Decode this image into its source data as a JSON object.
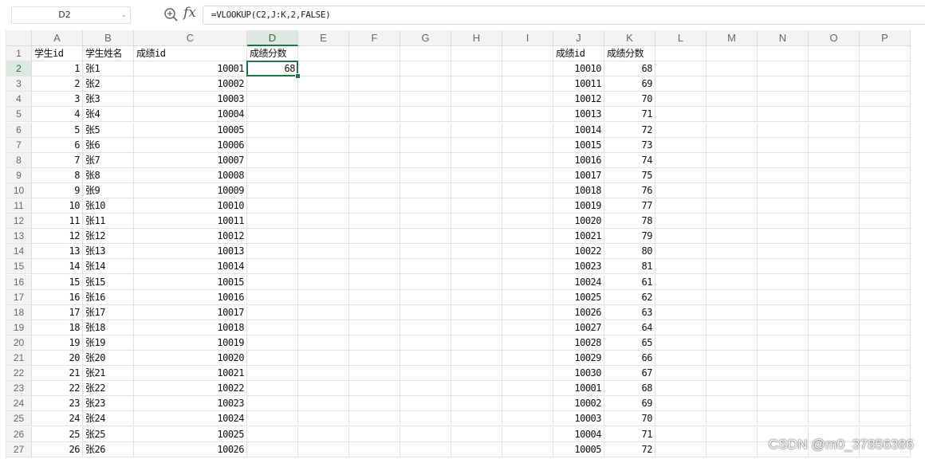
{
  "formula_bar": {
    "namebox": "D2",
    "fx_label": "fx",
    "formula": "=VLOOKUP(C2,J:K,2,FALSE)"
  },
  "columns": [
    "A",
    "B",
    "C",
    "D",
    "E",
    "F",
    "G",
    "H",
    "I",
    "J",
    "K",
    "L",
    "M",
    "N",
    "O",
    "P"
  ],
  "selected_column": "D",
  "selected_row": 2,
  "rows": [
    1,
    2,
    3,
    4,
    5,
    6,
    7,
    8,
    9,
    10,
    11,
    12,
    13,
    14,
    15,
    16,
    17,
    18,
    19,
    20,
    21,
    22,
    23,
    24,
    25,
    26,
    27
  ],
  "left_headers": [
    "学生id",
    "学生姓名",
    "成绩id",
    "成绩分数"
  ],
  "left_table": [
    [
      "1",
      "张1",
      "10001",
      "68"
    ],
    [
      "2",
      "张2",
      "10002",
      ""
    ],
    [
      "3",
      "张3",
      "10003",
      ""
    ],
    [
      "4",
      "张4",
      "10004",
      ""
    ],
    [
      "5",
      "张5",
      "10005",
      ""
    ],
    [
      "6",
      "张6",
      "10006",
      ""
    ],
    [
      "7",
      "张7",
      "10007",
      ""
    ],
    [
      "8",
      "张8",
      "10008",
      ""
    ],
    [
      "9",
      "张9",
      "10009",
      ""
    ],
    [
      "10",
      "张10",
      "10010",
      ""
    ],
    [
      "11",
      "张11",
      "10011",
      ""
    ],
    [
      "12",
      "张12",
      "10012",
      ""
    ],
    [
      "13",
      "张13",
      "10013",
      ""
    ],
    [
      "14",
      "张14",
      "10014",
      ""
    ],
    [
      "15",
      "张15",
      "10015",
      ""
    ],
    [
      "16",
      "张16",
      "10016",
      ""
    ],
    [
      "17",
      "张17",
      "10017",
      ""
    ],
    [
      "18",
      "张18",
      "10018",
      ""
    ],
    [
      "19",
      "张19",
      "10019",
      ""
    ],
    [
      "20",
      "张20",
      "10020",
      ""
    ],
    [
      "21",
      "张21",
      "10021",
      ""
    ],
    [
      "22",
      "张22",
      "10022",
      ""
    ],
    [
      "23",
      "张23",
      "10023",
      ""
    ],
    [
      "24",
      "张24",
      "10024",
      ""
    ],
    [
      "25",
      "张25",
      "10025",
      ""
    ],
    [
      "26",
      "张26",
      "10026",
      ""
    ]
  ],
  "right_headers": [
    "成绩id",
    "成绩分数"
  ],
  "right_table": [
    [
      "10010",
      "68"
    ],
    [
      "10011",
      "69"
    ],
    [
      "10012",
      "70"
    ],
    [
      "10013",
      "71"
    ],
    [
      "10014",
      "72"
    ],
    [
      "10015",
      "73"
    ],
    [
      "10016",
      "74"
    ],
    [
      "10017",
      "75"
    ],
    [
      "10018",
      "76"
    ],
    [
      "10019",
      "77"
    ],
    [
      "10020",
      "78"
    ],
    [
      "10021",
      "79"
    ],
    [
      "10022",
      "80"
    ],
    [
      "10023",
      "81"
    ],
    [
      "10024",
      "61"
    ],
    [
      "10025",
      "62"
    ],
    [
      "10026",
      "63"
    ],
    [
      "10027",
      "64"
    ],
    [
      "10028",
      "65"
    ],
    [
      "10029",
      "66"
    ],
    [
      "10030",
      "67"
    ],
    [
      "10001",
      "68"
    ],
    [
      "10002",
      "69"
    ],
    [
      "10003",
      "70"
    ],
    [
      "10004",
      "71"
    ],
    [
      "10005",
      "72"
    ]
  ],
  "watermark": "CSDN @m0_37856386",
  "colors": {
    "accent": "#217346",
    "header_bg": "#f3f3f3",
    "grid_line": "#e2e2e2"
  }
}
